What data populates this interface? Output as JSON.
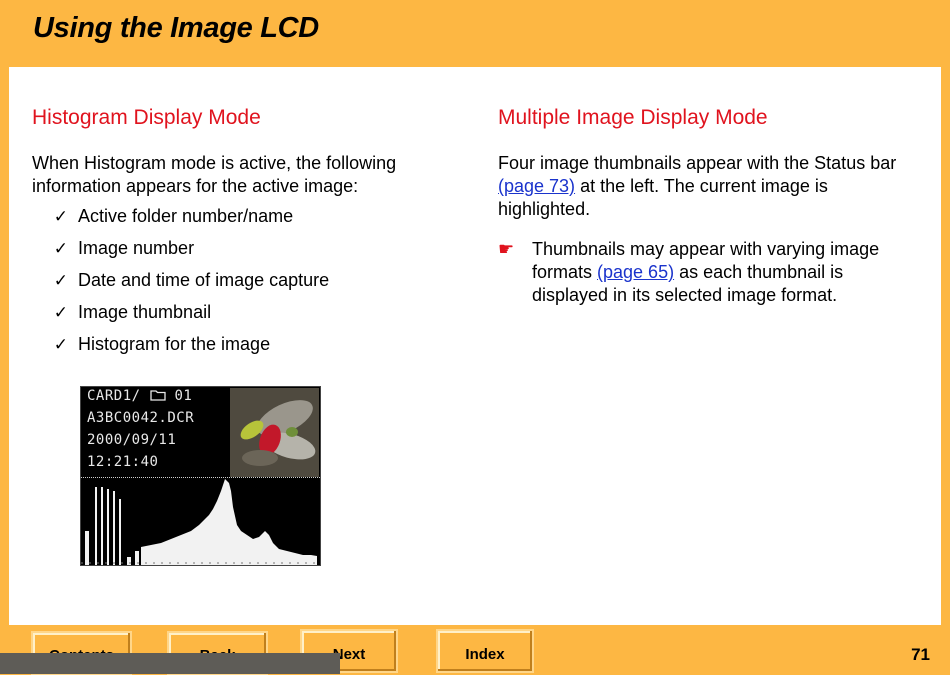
{
  "header": {
    "title": "Using the Image LCD"
  },
  "left": {
    "heading": "Histogram Display Mode",
    "intro": "When Histogram mode is active, the following information appears for the active image:",
    "items": [
      "Active folder number/name",
      "Image number",
      "Date and time of image capture",
      "Image thumbnail",
      "Histogram for the image"
    ],
    "check_glyph": "✓"
  },
  "lcd": {
    "line1_prefix": "CARD1/",
    "line1_folder": "01",
    "line2": "A3BC0042.DCR",
    "line3": "2000/09/11",
    "line4": "12:21:40"
  },
  "right": {
    "heading": "Multiple Image Display Mode",
    "para_before_link": "Four image thumbnails appear with the Status bar ",
    "para_link": "(page 73)",
    "para_after_link": " at the left. The current image is highlighted.",
    "note_before_link": "Thumbnails may appear with varying image formats ",
    "note_link": "(page 65)",
    "note_after_link": " as each thumbnail is displayed in its selected image format.",
    "note_glyph": "☛"
  },
  "footer": {
    "contents_label": "Contents",
    "back_label": "Back",
    "next_label": "Next",
    "index_label": "Index",
    "page_number": "71"
  },
  "colors": {
    "background": "#fdb743",
    "heading_red": "#e0131e",
    "link_blue": "#1a33cc"
  }
}
